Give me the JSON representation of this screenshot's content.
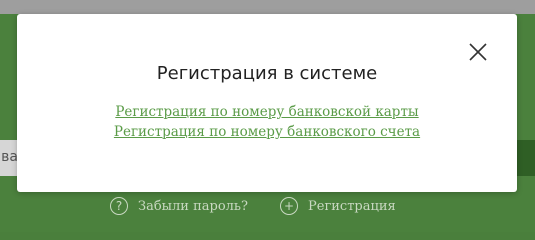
{
  "background": {
    "input_partial_text": "ва",
    "footer": {
      "forgot_password": "Забыли пароль?",
      "register": "Регистрация"
    }
  },
  "modal": {
    "title": "Регистрация в системе",
    "links": [
      {
        "label": "Регистрация по номеру банковской карты"
      },
      {
        "label": "Регистрация по номеру банковского счета"
      }
    ]
  },
  "colors": {
    "brand_green": "#4b813d",
    "link_green": "#5a9b47",
    "overlay_gray": "#9e9e9e"
  },
  "icons": {
    "close": "close-icon",
    "help": "question-circle-icon",
    "plus": "plus-circle-icon"
  }
}
